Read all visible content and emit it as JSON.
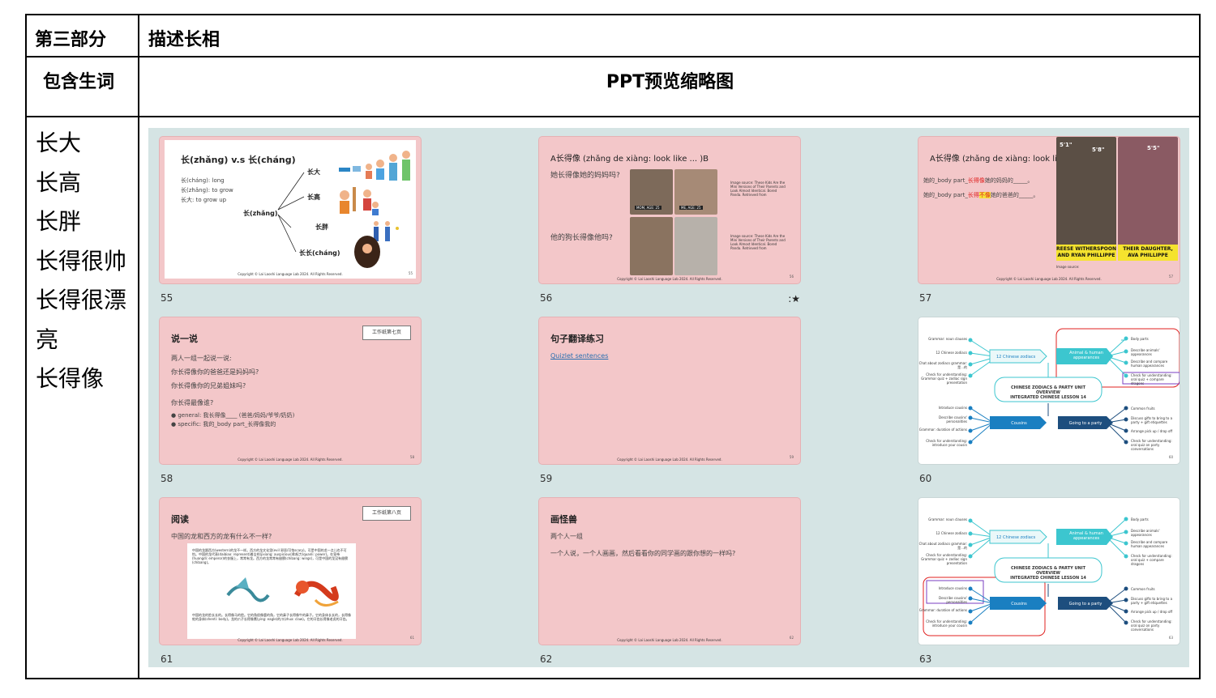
{
  "table": {
    "part_label": "第三部分",
    "part_title": "描述长相",
    "vocab_header": "包含生词",
    "ppt_header": "PPT预览缩略图",
    "vocab": [
      "长大",
      "长高",
      "长胖",
      "长得很帅",
      "长得很漂亮",
      "长得像"
    ]
  },
  "slides": [
    {
      "num": "55",
      "title": "长(zhǎng) v.s 长(cháng)",
      "lines": [
        "长(cháng): long",
        "长(zhǎng): to grow",
        "长大: to grow up"
      ],
      "center": "长(zhǎng)",
      "branches": [
        "长大",
        "长高",
        "长胖",
        "长长(cháng)"
      ],
      "footer": "Copyright © Lai Laoshi Language Lab 2024. All Rights Reserved.",
      "page": "55"
    },
    {
      "num": "56",
      "title": "A长得像 (zhǎng de xiàng: look like ... )B",
      "q1": "她长得像她的妈妈吗?",
      "q2": "他的狗长得像他吗?",
      "badge_mom": "MOM, AGE: 25",
      "badge_me": "ME, AGE: 25",
      "source1": "Image source: These Kids Are the Mini Versions of Their Parents and Look Almost Identical. Bored Panda. Retrieved from",
      "source2": "Image source: These Kids Are the Mini Versions of Their Parents and Look Almost Identical. Bored Panda. Retrieved from",
      "footer": "Copyright © Lai Laoshi Language Lab 2024. All Rights Reserved.",
      "page": "56",
      "star": ":★"
    },
    {
      "num": "57",
      "title": "A长得像 (zhǎng de xiàng: look like ... )B",
      "line1_a": "她的_body part_",
      "line1_b": "长得像",
      "line1_c": "她的妈妈的_____。",
      "line2_a": "她的_body part_",
      "line2_b": "长得",
      "line2_c": "不像",
      "line2_d": "她的爸爸的_____。",
      "height1": "5'1\"",
      "height2": "5'8\"",
      "height3": "5'5\"",
      "cap1": "REESE WITHERSPOON AND RYAN PHILLIPPE",
      "cap2": "THEIR DAUGHTER, AVA PHILLIPPE",
      "source": "Image source:",
      "footer": "Copyright © Lai Laoshi Language Lab 2024. All Rights Reserved.",
      "page": "57"
    },
    {
      "num": "58",
      "title": "说一说",
      "button": "工作纸第七页",
      "lines": [
        "两人一组一起说一说:",
        "你长得像你的爸爸还是妈妈吗?",
        "你长得像你的兄弟姐妹吗?",
        "你长得最像谁?"
      ],
      "bullets": [
        "general: 我长得像____ (爸爸/妈妈/爷爷/奶奶)",
        "specific: 我的_body part_长得像我的"
      ],
      "footer": "Copyright © Lai Laoshi Language Lab 2024. All Rights Reserved.",
      "page": "58"
    },
    {
      "num": "59",
      "title": "句子翻译练习",
      "link": "Quizlet sentences",
      "footer": "Copyright © Lai Laoshi Language Lab 2024. All Rights Reserved.",
      "page": "59"
    },
    {
      "num": "60",
      "center_line1": "CHINESE ZODIACS & PARTY UNIT OVERVIEW",
      "center_line2": "INTEGRATED CHINESE LESSON 14",
      "node1": "12 Chinese zodiacs",
      "node2": "Animal & human appearances",
      "node3": "Cousins",
      "node4": "Going to a party",
      "left_top": [
        "Grammar: noun clauses",
        "12 Chinese zodiacs",
        "Chat about zodiacs grammar: 是...的",
        "Check for understanding: Grammar quiz + zodiac sign presentation"
      ],
      "left_bottom": [
        "Introduce cousins",
        "Describe cousins' personalities",
        "Grammar: duration of actions",
        "Check for understanding: introduce your cousin"
      ],
      "right_top": [
        "Body parts",
        "Describe animals' appearances",
        "Describe and compare human appearances",
        "Check for understanding: oral quiz + compare dragons"
      ],
      "right_bottom": [
        "Common fruits",
        "Discuss gifts to bring to a party + gift etiquettes",
        "Arrange pick up / drop off",
        "Check for understanding: oral quiz on party conversations"
      ],
      "page": "60"
    },
    {
      "num": "61",
      "title": "阅读",
      "button": "工作纸第八页",
      "question": "中国的龙和西方的龙有什么不一样?",
      "para1": "中国的龙跟西方(western)的龙不一样。西方的龙文化里(evil 邪恶/可怕scary)。可是中国的龙一点儿也不可怕。中国的龙代表(daibiao: represent)着吉祥(jixiang: auspicious)和权力(quanli: power)。在皇帝(huangdi: emperor)的衣服上，常常有龙。西方的龙常常有翅膀(chibang: wings)，可是中国的龙没有翅膀(chibang)。",
      "para2": "中国的龙的脸长长的。长得像马的脸。它的角很像鹿的角，它的鼻子长得像牛的鼻子。它的身体长长的，长得像蛇的身体(shenti: body)。龙的爪子长得像鹰(ying: eagle)的爪(zhua: claw)。它的牙齿长得像老虎的牙齿。",
      "footer": "Copyright © Lai Laoshi Language Lab 2024. All Rights Reserved.",
      "page": "61"
    },
    {
      "num": "62",
      "title": "画怪兽",
      "lines": [
        "两个人一组",
        "一个人说，一个人画画，然后看看你的同学画的跟你想的一样吗?"
      ],
      "footer": "Copyright © Lai Laoshi Language Lab 2024. All Rights Reserved.",
      "page": "62"
    },
    {
      "num": "63",
      "page": "63"
    }
  ],
  "colors": {
    "slide_pink": "#f3c7c9",
    "preview_bg": "#d5e4e4",
    "accent_red": "#e0201f",
    "teal": "#3cc6cf",
    "navy": "#1d4e7e",
    "blue": "#1a7fc1"
  }
}
